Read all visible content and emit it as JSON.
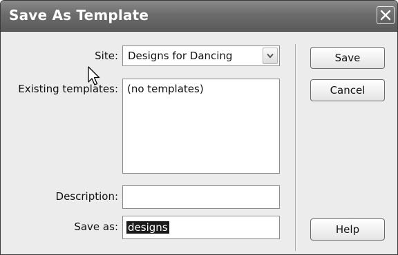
{
  "window": {
    "title": "Save As Template"
  },
  "form": {
    "site_label": "Site:",
    "site_value": "Designs for Dancing",
    "existing_label": "Existing templates:",
    "existing_items": [
      "(no templates)"
    ],
    "description_label": "Description:",
    "description_value": "",
    "save_as_label": "Save as:",
    "save_as_value": "designs"
  },
  "buttons": {
    "save": "Save",
    "cancel": "Cancel",
    "help": "Help"
  },
  "icons": {
    "close": "close-icon",
    "dropdown": "chevron-down-icon",
    "cursor": "mouse-pointer-icon"
  }
}
